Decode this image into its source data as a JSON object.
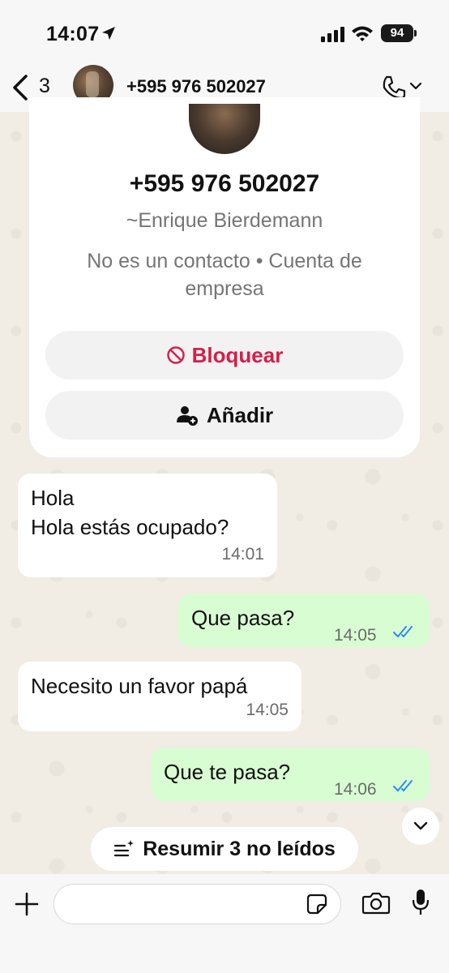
{
  "status": {
    "time": "14:07",
    "battery": "94"
  },
  "header": {
    "back_count": "3",
    "title": "+595 976 502027"
  },
  "contact": {
    "number": "+595 976 502027",
    "name": "~Enrique Bierdemann",
    "info": "No es un contacto • Cuenta de empresa",
    "block_label": "Bloquear",
    "add_label": "Añadir"
  },
  "messages": [
    {
      "direction": "in",
      "lines": [
        "Hola",
        "Hola estás ocupado?"
      ],
      "time": "14:01"
    },
    {
      "direction": "out",
      "text": "Que pasa?",
      "time": "14:05",
      "status": "read"
    },
    {
      "direction": "in",
      "text": "Necesito un favor papá",
      "time": "14:05"
    },
    {
      "direction": "out",
      "text": "Que te pasa?",
      "time": "14:06",
      "status": "read"
    }
  ],
  "summarize_label": "Resumir 3 no leídos",
  "composer": {
    "placeholder": ""
  },
  "colors": {
    "block": "#d51f4a",
    "outgoing_bubble": "#d9fdd3",
    "read_ticks": "#2c8bf0"
  }
}
